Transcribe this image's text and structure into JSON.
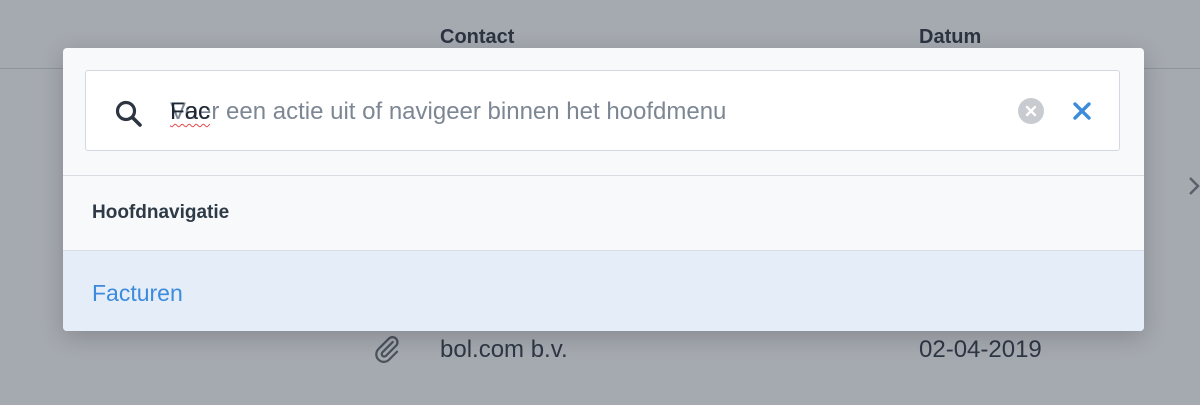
{
  "background": {
    "columns": {
      "contact": "Contact",
      "datum": "Datum"
    },
    "row": {
      "contact": "bol.com b.v.",
      "datum": "02-04-2019",
      "attachment_icon": "paperclip-icon"
    }
  },
  "command_palette": {
    "search": {
      "value": "Fac",
      "placeholder": "Voer een actie uit of navigeer binnen het hoofdmenu",
      "icons": {
        "search": "search-icon",
        "clear": "clear-circle-icon",
        "close": "close-x-icon"
      }
    },
    "section_title": "Hoofdnavigatie",
    "results": [
      {
        "label": "Facturen",
        "highlighted": true
      }
    ]
  },
  "colors": {
    "overlay": "#a5a9b0",
    "modal_bg": "#f7f9fb",
    "accent": "#3c8bdc",
    "highlight": "#e4edf8"
  }
}
